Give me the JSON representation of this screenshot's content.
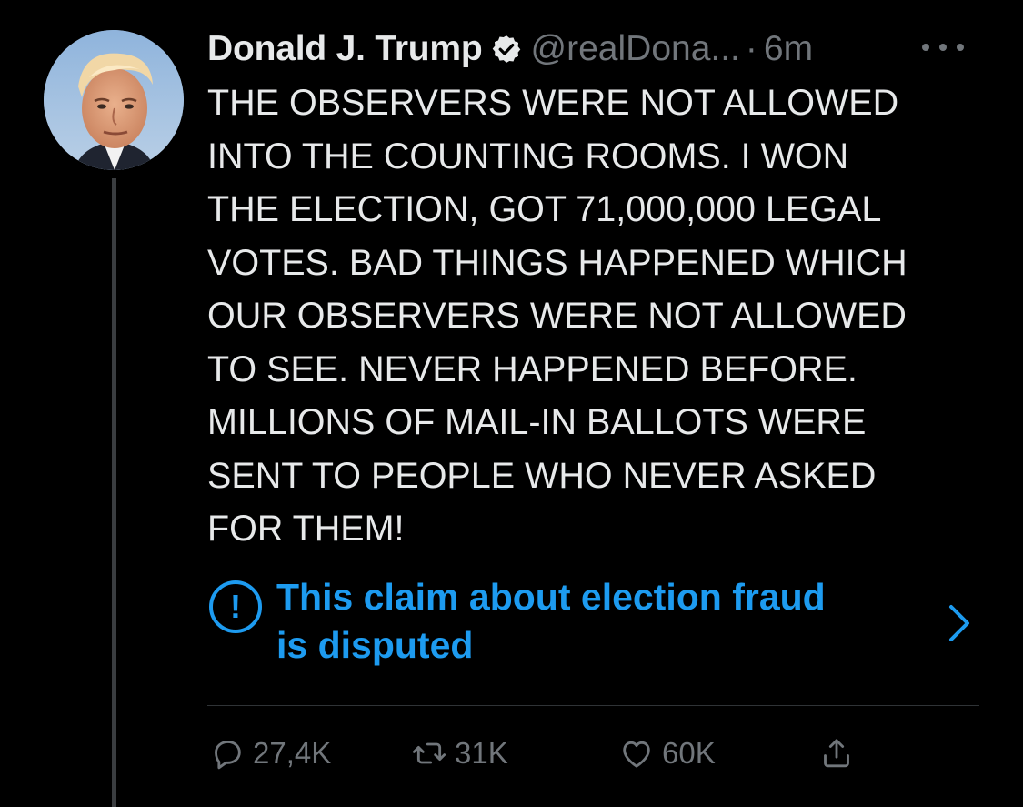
{
  "author": {
    "display_name": "Donald J. Trump",
    "handle": "@realDona...",
    "separator": "·",
    "time": "6m",
    "verified": true
  },
  "tweet": {
    "lines": [
      "THE OBSERVERS WERE NOT ALLOWED",
      "INTO THE COUNTING ROOMS. I WON",
      "THE ELECTION, GOT 71,000,000 LEGAL",
      "VOTES. BAD THINGS HAPPENED WHICH",
      "OUR OBSERVERS WERE NOT ALLOWED",
      "TO SEE. NEVER HAPPENED BEFORE.",
      "MILLIONS OF MAIL-IN BALLOTS WERE",
      "SENT TO PEOPLE WHO NEVER ASKED",
      "FOR THEM!"
    ]
  },
  "notice": {
    "icon": "exclamation-circle-icon",
    "glyph": "!",
    "lines": [
      "This claim about election fraud",
      "is disputed"
    ]
  },
  "actions": {
    "reply_count": "27,4K",
    "retweet_count": "31K",
    "like_count": "60K",
    "icons": [
      "reply-icon",
      "retweet-icon",
      "like-icon",
      "share-icon"
    ]
  },
  "colors": {
    "background": "#000000",
    "text": "#e7e9ea",
    "secondary": "#71767b",
    "accent": "#1d9bf0",
    "divider": "#2f3336"
  }
}
